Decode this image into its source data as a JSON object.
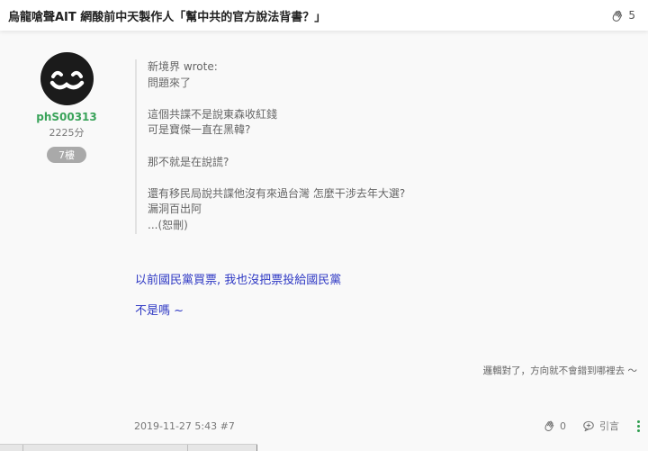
{
  "topbar": {
    "title": "烏龍嗆聲AIT 網酸前中天製作人「幫中共的官方說法背書？」",
    "like_count": "5"
  },
  "post": {
    "author": {
      "name": "phS00313",
      "score": "2225分",
      "floor": "7樓"
    },
    "quote": {
      "header": "新境界 wrote:",
      "lines": [
        "問題來了",
        "",
        "這個共諜不是說東森收紅錢",
        "可是寶傑一直在黑韓?",
        "",
        "那不就是在說謊?",
        "",
        "還有移民局說共諜他沒有來過台灣 怎麼干涉去年大選?",
        "漏洞百出阿",
        "...(恕刪)"
      ]
    },
    "reply": {
      "line1": "以前國民黨買票, 我也沒把票投給國民黨",
      "line2": "不是嗎 ~"
    },
    "signature": "邏輯對了，方向就不會錯到哪裡去 ～",
    "footer": {
      "timestamp": "2019-11-27 5:43 #7",
      "like_count": "0",
      "quote_label": "引言"
    }
  },
  "colors": {
    "author_name": "#3aa35a",
    "reply_text": "#2e38c4",
    "badge_bg": "#a9a9a9"
  },
  "icons": {
    "like": "clap-hand-icon",
    "quote": "quote-bubble-icon",
    "more": "vertical-dots-icon"
  }
}
